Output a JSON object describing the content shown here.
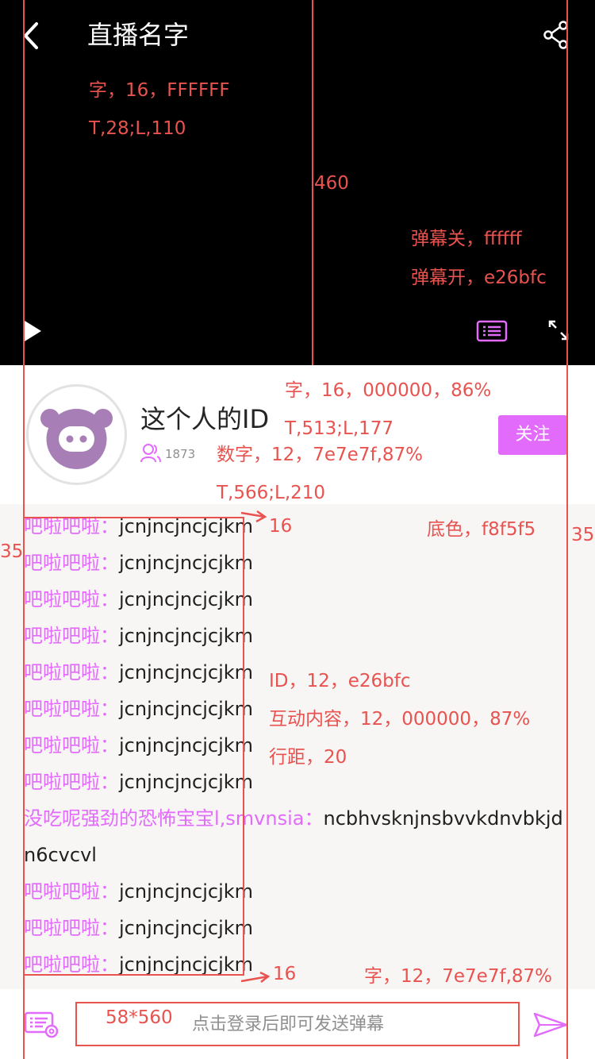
{
  "header": {
    "title": "直播名字"
  },
  "info": {
    "user_id": "这个人的ID",
    "viewer_count": "1873",
    "follow_label": "关注"
  },
  "chat": {
    "messages": [
      {
        "name": "吧啦吧啦：",
        "text": "jcnjncjncjcjkm"
      },
      {
        "name": "吧啦吧啦：",
        "text": "jcnjncjncjcjkm"
      },
      {
        "name": "吧啦吧啦：",
        "text": "jcnjncjncjcjkm"
      },
      {
        "name": "吧啦吧啦：",
        "text": "jcnjncjncjcjkm"
      },
      {
        "name": "吧啦吧啦：",
        "text": "jcnjncjncjcjkm"
      },
      {
        "name": "吧啦吧啦：",
        "text": "jcnjncjncjcjkm"
      },
      {
        "name": "吧啦吧啦：",
        "text": "jcnjncjncjcjkm"
      },
      {
        "name": "吧啦吧啦：",
        "text": "jcnjncjncjcjkm"
      },
      {
        "name": "没吃呢强劲的恐怖宝宝l,smvnsia：",
        "text": "ncbhvsknjnsbvvkdnvbkjdn6cvcvl"
      },
      {
        "name": "吧啦吧啦：",
        "text": "jcnjncjncjcjkm"
      },
      {
        "name": "吧啦吧啦：",
        "text": "jcnjncjncjcjkm"
      },
      {
        "name": "吧啦吧啦：",
        "text": "jcnjncjncjcjkm"
      }
    ]
  },
  "input": {
    "placeholder": "点击登录后即可发送弹幕"
  },
  "annotations": {
    "title_font": "字，16，FFFFFF",
    "title_pos": "T,28;L,110",
    "video_height": "460",
    "danmu_off": "弹幕关，ffffff",
    "danmu_on": "弹幕开，e26bfc",
    "id_font": "字，16，000000，86%",
    "id_pos": "T,513;L,177",
    "count_font": "数字，12，7e7e7f,87%",
    "count_pos": "T,566;L,210",
    "gap_top": "16",
    "margin_left": "35",
    "bg_color": "底色，f8f5f5",
    "margin_right": "35",
    "chat_id_font": "ID，12，e26bfc",
    "chat_content_font": "互动内容，12，000000，87%",
    "line_spacing": "行距，20",
    "gap_bottom": "16",
    "input_font": "字，12，7e7e7f,87%",
    "input_size": "58*560"
  },
  "colors": {
    "accent": "#e26bfc",
    "background": "#f8f5f5",
    "annotation": "#e8534f"
  },
  "icons": [
    "back-icon",
    "share-icon",
    "play-icon",
    "danmu-icon",
    "fullscreen-icon",
    "avatar-pig-icon",
    "viewers-icon",
    "settings-icon",
    "send-icon"
  ]
}
